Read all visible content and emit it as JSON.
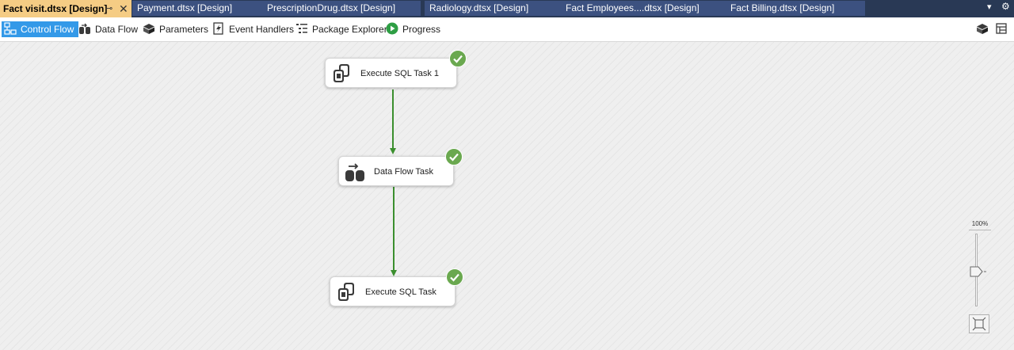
{
  "tabs": [
    {
      "label": "Fact visit.dtsx [Design]",
      "active": true
    },
    {
      "label": "Payment.dtsx [Design]",
      "active": false
    },
    {
      "label": "PrescriptionDrug.dtsx [Design]",
      "active": false
    },
    {
      "label": "Radiology.dtsx [Design]",
      "active": false
    },
    {
      "label": "Fact Employees....dtsx [Design]",
      "active": false
    },
    {
      "label": "Fact Billing.dtsx [Design]",
      "active": false
    }
  ],
  "tab_pin_glyph": "⊸",
  "tab_close_glyph": "✕",
  "tab_menu_glyph": "▾",
  "tab_gear_glyph": "⚙",
  "toolbar": {
    "items": [
      {
        "label": "Control Flow",
        "icon": "control-flow-icon",
        "active": true
      },
      {
        "label": "Data Flow",
        "icon": "data-flow-icon",
        "active": false
      },
      {
        "label": "Parameters",
        "icon": "parameters-icon",
        "active": false
      },
      {
        "label": "Event Handlers",
        "icon": "event-handlers-icon",
        "active": false
      },
      {
        "label": "Package Explorer",
        "icon": "package-explorer-icon",
        "active": false
      },
      {
        "label": "Progress",
        "icon": "progress-icon",
        "active": false
      }
    ]
  },
  "tasks": [
    {
      "label": "Execute SQL Task 1",
      "type": "execute-sql",
      "status": "success"
    },
    {
      "label": "Data Flow Task",
      "type": "data-flow",
      "status": "success"
    },
    {
      "label": "Execute SQL Task",
      "type": "execute-sql",
      "status": "success"
    }
  ],
  "connectors": [
    {
      "from": "Execute SQL Task 1",
      "to": "Data Flow Task",
      "constraint": "success"
    },
    {
      "from": "Data Flow Task",
      "to": "Execute SQL Task",
      "constraint": "success"
    }
  ],
  "zoom": {
    "label": "100%",
    "level_percent": 100
  },
  "colors": {
    "tabstrip_bg": "#293955",
    "active_tab_bg": "#f5cc84",
    "inactive_tab_bg": "#3c5180",
    "active_toolbar_item": "#3399e8",
    "success_green": "#6aa84f",
    "connector_green": "#3b8f2e"
  }
}
